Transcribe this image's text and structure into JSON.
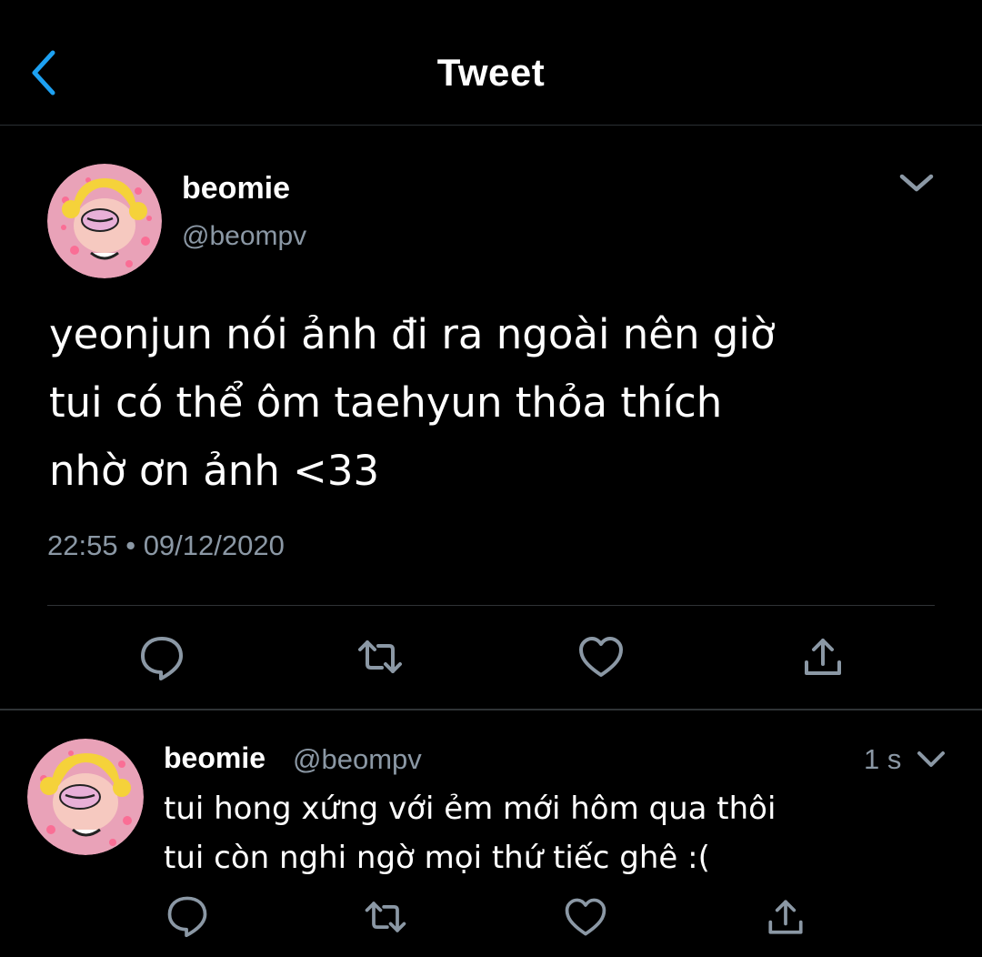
{
  "header": {
    "title": "Tweet",
    "back_icon": "chevron-left-icon"
  },
  "tweet": {
    "name": "beomie",
    "handle": "@beompv",
    "text": "yeonjun nói ảnh đi ra ngoài nên giờ\ntui có thể ôm taehyun thỏa thích\nnhờ ơn ảnh <33",
    "time": "22:55",
    "separator": "•",
    "date": "09/12/2020",
    "actions": [
      "reply-icon",
      "retweet-icon",
      "like-icon",
      "share-icon"
    ]
  },
  "reply": {
    "name": "beomie",
    "handle": "@beompv",
    "time": "1 s",
    "text": "tui hong xứng với ẻm mới hôm qua thôi\ntui còn nghi ngờ mọi thứ tiếc ghê :("
  },
  "colors": {
    "background": "#000000",
    "accent": "#1da1f2",
    "muted": "#8b98a5",
    "divider": "#2f3336"
  }
}
